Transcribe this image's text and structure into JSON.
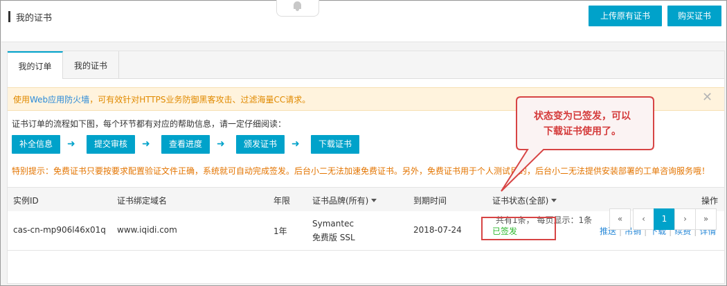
{
  "header": {
    "title": "我的证书",
    "upload_label": "上传原有证书",
    "buy_label": "购买证书"
  },
  "tabs": [
    {
      "label": "我的订单",
      "active": true
    },
    {
      "label": "我的证书",
      "active": false
    }
  ],
  "alert": {
    "text_before": "使用",
    "link_text": "Web应用防火墙",
    "text_after": "，可有效针对HTTPS业务防御黑客攻击、过滤海量CC请求。",
    "close_icon": "close-icon"
  },
  "flow": {
    "intro": "证书订单的流程如下图，每个环节都有对应的帮助信息，请一定仔细阅读：",
    "steps": [
      "补全信息",
      "提交审核",
      "查看进度",
      "颁发证书",
      "下载证书"
    ],
    "arrow": "➜"
  },
  "warning": "特别提示：免费证书只要按要求配置验证文件正确，系统就可自动完成签发。后台小二无法加速免费证书。另外，免费证书用于个人测试目的，后台小二无法提供安装部署的工单咨询服务哦！",
  "table": {
    "headers": {
      "instance_id": "实例ID",
      "domain": "证书绑定域名",
      "years": "年限",
      "brand": "证书品牌(所有)",
      "expires": "到期时间",
      "status": "证书状态(全部)",
      "actions": "操作"
    },
    "rows": [
      {
        "instance_id": "cas-cn-mp906l46x01q",
        "domain": "www.iqidi.com",
        "years": "1年",
        "brand_line1": "Symantec",
        "brand_line2": "免费版 SSL",
        "expires": "2018-07-24",
        "status": "已签发",
        "actions": [
          "推送",
          "吊销",
          "下载",
          "续费",
          "详情"
        ]
      }
    ]
  },
  "pagination": {
    "summary": "共有1条， 每页显示：1条",
    "first": "«",
    "prev": "‹",
    "current": "1",
    "next": "›",
    "last": "»"
  },
  "annotation": {
    "line1": "状态变为已签发，可以",
    "line2": "下载证书使用了。"
  },
  "colors": {
    "primary": "#00a2ca",
    "link": "#2a8ad8",
    "success": "#2db82d",
    "alert_bg": "#fff3dd",
    "warning": "#e37400",
    "annotation": "#d74444"
  }
}
